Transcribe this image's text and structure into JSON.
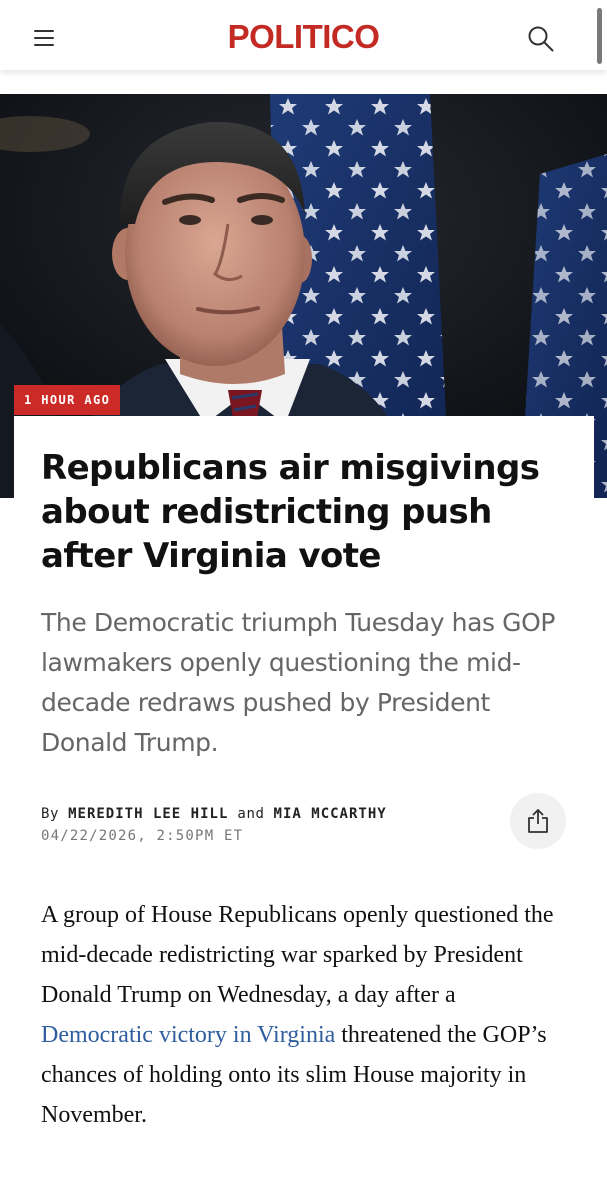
{
  "header": {
    "logo": "POLITICO",
    "brand_color": "#c42a24",
    "menu_icon": "hamburger-menu-icon",
    "search_icon": "search-icon"
  },
  "hero": {
    "badge": "1 HOUR AGO",
    "badge_color": "#cc2a27"
  },
  "article": {
    "headline": {
      "part1": "Republicans air ",
      "bold": "misgivings about redistricting push",
      "part2": " after Virginia vote"
    },
    "dek": "The Democratic triumph Tuesday has GOP lawmakers openly questioning the mid-decade redraws pushed by President Donald Trump.",
    "byline": {
      "prefix": "By",
      "author1": "MEREDITH LEE HILL",
      "conjunction": "and",
      "author2": "MIA MCCARTHY"
    },
    "timestamp": "04/22/2026, 2:50PM ET",
    "share_icon": "share-icon",
    "body": {
      "before_link": "A group of House Republicans openly questioned the mid-decade redistricting war sparked by President Donald Trump on Wednesday, a day after a ",
      "link_text": "Democratic victory in Virginia",
      "after_link": " threatened the GOP’s chances of holding onto its slim House majority in November."
    },
    "link_color": "#2f5e9e"
  }
}
